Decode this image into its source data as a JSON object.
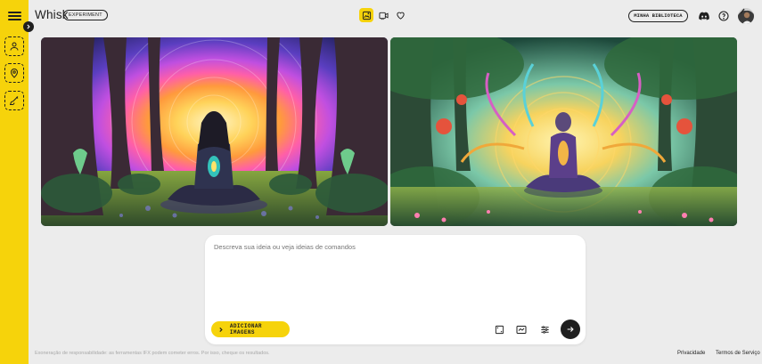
{
  "app": {
    "title": "Whisk",
    "badge": "EXPERIMENT"
  },
  "sidebar": {
    "tools": [
      {
        "icon": "person-icon",
        "label": ""
      },
      {
        "icon": "location-pin-icon",
        "label": ""
      },
      {
        "icon": "brush-icon",
        "label": ""
      }
    ]
  },
  "header": {
    "modes": [
      {
        "icon": "image-mode-icon",
        "active": true
      },
      {
        "icon": "video-mode-icon",
        "active": false
      },
      {
        "icon": "favorites-heart-icon",
        "active": false
      }
    ],
    "library_label": "MINHA BIBLIOTECA",
    "right_icons": [
      "discord-icon",
      "help-circle-icon"
    ]
  },
  "images": [
    {
      "description": "man meditating in a forest with concentric rainbow halo"
    },
    {
      "description": "woman meditating in a jungle with colorful mandala aura"
    }
  ],
  "prompt": {
    "placeholder": "Descreva sua ideia ou veja ideias de comandos",
    "value": "",
    "add_images_label": "ADICIONAR IMAGENS",
    "tools": [
      "aspect-ratio-square-icon",
      "aspect-ratio-landscape-icon",
      "settings-sliders-icon"
    ]
  },
  "footer": {
    "disclaimer": "Exoneração de responsabilidade: as ferramentas IFX podem cometer erros. Por isso, cheque os resultados.",
    "privacy_label": "Privacidade",
    "terms_label": "Termos de Serviço"
  },
  "colors": {
    "accent": "#f6d30b",
    "background": "#ececec",
    "dark": "#1f1f1f"
  }
}
